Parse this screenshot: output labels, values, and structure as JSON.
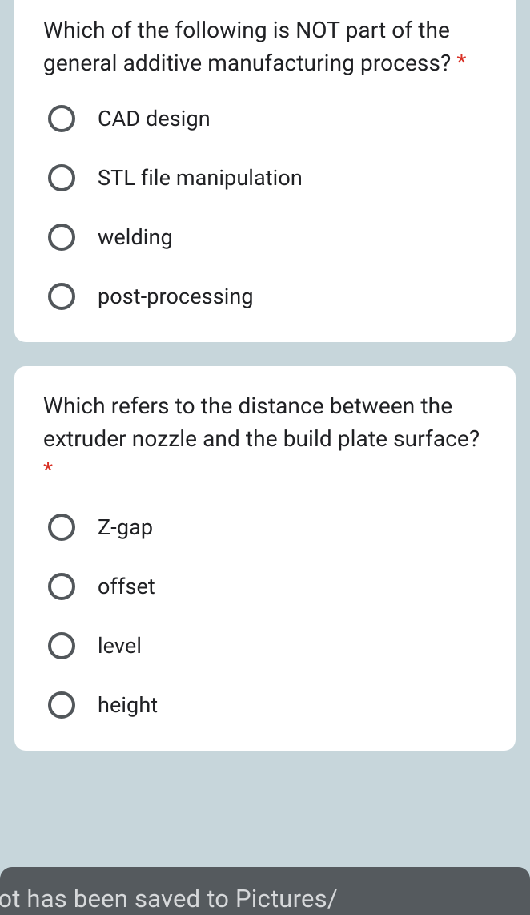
{
  "required_marker": "*",
  "questions": [
    {
      "text": "Which of the following is NOT part of the general additive manufacturing process?",
      "options": [
        "CAD design",
        "STL file manipulation",
        "welding",
        "post-processing"
      ]
    },
    {
      "text": "Which refers to the distance between the extruder nozzle and the build plate surface?",
      "options": [
        "Z-gap",
        "offset",
        "level",
        "height"
      ]
    }
  ],
  "toast_text": "not has been saved to  Pictures/"
}
